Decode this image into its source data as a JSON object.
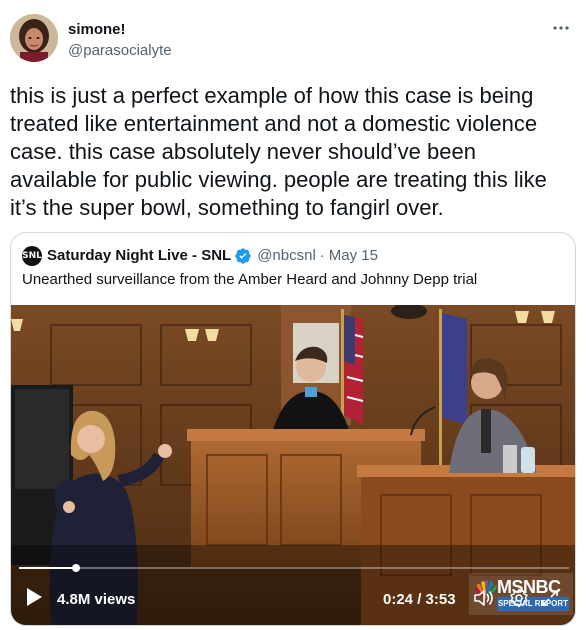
{
  "author": {
    "display_name": "simone!",
    "handle": "@parasocialyte",
    "avatar_icon": "avatar-photo"
  },
  "more_icon": "ellipsis-icon",
  "tweet": {
    "text": "this is just a perfect example of how this case is being\ntreated like entertainment and not a domestic violence\ncase. this case absolutely never should’ve been\navailable for public viewing. people are treating this like\nit’s the super bowl, something to fangirl over."
  },
  "quoted_tweet": {
    "logo_text": "SNL",
    "display_name": "Saturday Night Live - SNL",
    "verified": true,
    "handle": "@nbcsnl",
    "separator": "·",
    "date": "May 15",
    "text": "Unearthed surveillance from the Amber Heard and Johnny Depp trial"
  },
  "video": {
    "views": "4.8M views",
    "timecode": "0:24 / 3:53",
    "progress": 0.103,
    "watermark": "MSNBC",
    "watermark_sub": "SPECIAL REPORT"
  },
  "colors": {
    "text_primary": "#0f1419",
    "text_secondary": "#536471",
    "border": "#cfd9de",
    "verified_blue": "#1d9bf0"
  }
}
